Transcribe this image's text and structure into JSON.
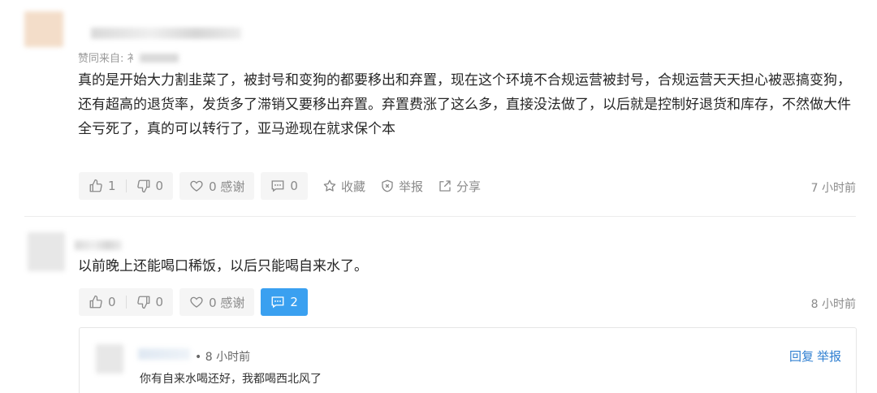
{
  "comment1": {
    "agree_label": "赞同来自: 衤",
    "text": "真的是开始大力割韭菜了，被封号和变狗的都要移出和弃置，现在这个环境不合规运营被封号，合规运营天天担心被恶搞变狗，还有超高的退货率，发货多了滞销又要移出弃置。弃置费涨了这么多，直接没法做了，以后就是控制好退货和库存，不然做大件全亏死了，真的可以转行了，亚马逊现在就求保个本",
    "actions": {
      "like": "1",
      "dislike": "0",
      "thanks": "0 感谢",
      "comments": "0",
      "favorite": "收藏",
      "report": "举报",
      "share": "分享"
    },
    "time": "7 小时前"
  },
  "comment2": {
    "text": "以前晚上还能喝口稀饭，以后只能喝自来水了。",
    "actions": {
      "like": "0",
      "dislike": "0",
      "thanks": "0 感谢",
      "comments": "2"
    },
    "time": "8 小时前"
  },
  "reply": {
    "time": "• 8 小时前",
    "text": "你有自来水喝还好，我都喝西北风了",
    "reply_link": "回复",
    "report_link": "举报"
  },
  "colors": {
    "accent": "#3aa0f0",
    "link": "#2f7fd1",
    "muted": "#8a8a8a"
  }
}
